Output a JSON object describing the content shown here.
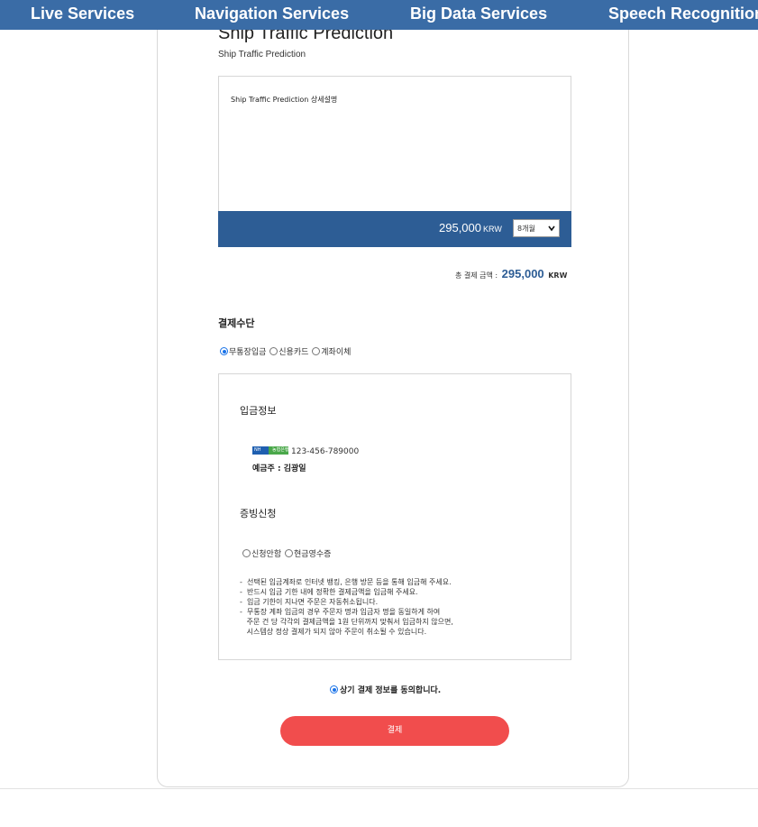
{
  "nav": {
    "items": [
      "Live Services",
      "Navigation Services",
      "Big Data Services",
      "Speech Recognition"
    ]
  },
  "product": {
    "title": "Ship Traffic Prediction",
    "subtitle": "Ship Traffic Prediction",
    "description": "Ship Traffic Prediction 상세설명",
    "price": "295,000",
    "currency": "KRW",
    "period_selected": "8개월"
  },
  "total": {
    "label": "총 결제 금액 :",
    "amount": "295,000",
    "currency": "KRW"
  },
  "payment": {
    "section_title": "결제수단",
    "methods": [
      "무통장입금",
      "신용카드",
      "계좌이체"
    ],
    "selected_index": 0
  },
  "deposit": {
    "heading": "입금정보",
    "bank_logo_text": [
      "NH",
      "농협은행"
    ],
    "account_number": "123-456-789000",
    "holder": "예금주 : 김광일",
    "proof_heading": "증빙신청",
    "proof_options": [
      "신청안함",
      "현금영수증"
    ],
    "notes": [
      "-  선택된 입금계좌로 인터넷 뱅킹, 은행 방문 등을 통해 입금해 주세요.",
      "-  반드시 입금 기한 내에 정확한 결제금액을 입금해 주세요.",
      "-  입금 기한이 지나면 주문은 자동취소됩니다.",
      "-  무통장 계좌 입금의 경우 주문자 명과 입금자 명을 동일하게 하여",
      "   주문 건 당 각각의 결제금액을 1원 단위까지 맞춰서 입금하지 않으면,",
      "   시스템상 정상 결제가 되지 않아 주문이 취소될 수 있습니다."
    ]
  },
  "agree_label": "상기 결제 정보를 동의합니다.",
  "pay_button_label": "결제",
  "colors": {
    "nav": "#3a6ca6",
    "price_bar": "#2d5d95",
    "pay_button": "#f14d4d",
    "radio_on": "#1a73e8"
  }
}
